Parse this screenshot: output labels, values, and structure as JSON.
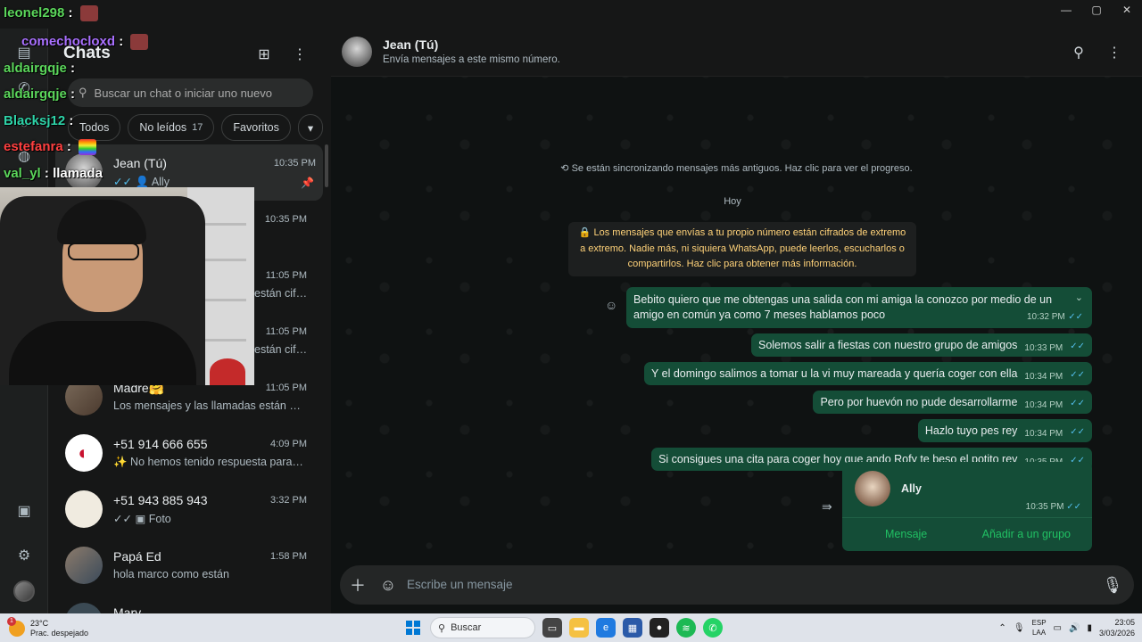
{
  "window_controls": {
    "minimize": "—",
    "maximize": "▢",
    "close": "✕"
  },
  "sidebar": {
    "title": "Chats",
    "search_placeholder": "Buscar un chat o iniciar uno nuevo",
    "filters": [
      {
        "label": "Todos"
      },
      {
        "label": "No leídos",
        "count": "17"
      },
      {
        "label": "Favoritos"
      }
    ],
    "chats": [
      {
        "name": "Jean (Tú)",
        "time": "10:35 PM",
        "preview": "Ally",
        "pinned": true
      },
      {
        "name": "",
        "time": "10:35 PM",
        "preview": ""
      },
      {
        "name": "",
        "time": "11:05 PM",
        "preview": "están cifr..."
      },
      {
        "name": "",
        "time": "11:05 PM",
        "preview": "están cifr..."
      },
      {
        "name": "Madre🤗",
        "time": "11:05 PM",
        "preview": "Los mensajes y las llamadas están cifr..."
      },
      {
        "name": "+51 914 666 655",
        "time": "4:09 PM",
        "preview": "✨ No hemos tenido respuesta para c..."
      },
      {
        "name": "+51 943 885 943",
        "time": "3:32 PM",
        "preview": "Foto"
      },
      {
        "name": "Papá Ed",
        "time": "1:58 PM",
        "preview": "hola marco como están"
      },
      {
        "name": "Mary",
        "time": "",
        "preview": ""
      }
    ]
  },
  "conversation": {
    "name": "Jean (Tú)",
    "subtitle": "Envía mensajes a este mismo número.",
    "sync_notice": "Se están sincronizando mensajes más antiguos. Haz clic para ver el progreso.",
    "day_label": "Hoy",
    "encryption_note": "Los mensajes que envías a tu propio número están cifrados de extremo a extremo. Nadie más, ni siquiera WhatsApp, puede leerlos, escucharlos o compartirlos. Haz clic para obtener más información.",
    "messages": [
      {
        "text": "Bebito quiero que me obtengas una salida con mi amiga la conozco por medio de un amigo en común ya como 7 meses hablamos poco",
        "time": "10:32 PM"
      },
      {
        "text": "Solemos salir a fiestas con nuestro grupo de amigos",
        "time": "10:33 PM"
      },
      {
        "text": "Y el domingo salimos a tomar u la vi muy mareada y quería coger con ella",
        "time": "10:34 PM"
      },
      {
        "text": "Pero por huevón no pude desarrollarme",
        "time": "10:34 PM"
      },
      {
        "text": "Hazlo tuyo pes rey",
        "time": "10:34 PM"
      },
      {
        "text": "Si consigues una cita para coger hoy que ando Rofy te beso el potito rey",
        "time": "10:35 PM"
      }
    ],
    "contact_card": {
      "name": "Ally",
      "time": "10:35 PM",
      "action_message": "Mensaje",
      "action_group": "Añadir a un grupo"
    },
    "composer_placeholder": "Escribe un mensaje"
  },
  "stream_chat": [
    {
      "user": "leonel298",
      "text": "",
      "color": "#5bd65b"
    },
    {
      "user": "comechocloxd",
      "text": "",
      "color": "#a970ff"
    },
    {
      "user": "aldairgqje",
      "text": "",
      "color": "#5bd65b"
    },
    {
      "user": "aldairgqje",
      "text": "",
      "color": "#5bd65b"
    },
    {
      "user": "Blacksj12",
      "text": "",
      "color": "#2ed3a8"
    },
    {
      "user": "estefanra",
      "text": "",
      "color": "#ff4040"
    },
    {
      "user": "val_yl",
      "text": "llamada",
      "color": "#5bd65b"
    }
  ],
  "taskbar": {
    "weather_temp": "23°C",
    "weather_desc": "Prac. despejado",
    "weather_badge": "1",
    "search_label": "Buscar",
    "lang_top": "ESP",
    "lang_bottom": "LAA",
    "time": "23:05",
    "date": "3/03/2026"
  },
  "colors": {
    "bubble": "#144d37",
    "accent": "#21c063",
    "panel": "#161717"
  }
}
